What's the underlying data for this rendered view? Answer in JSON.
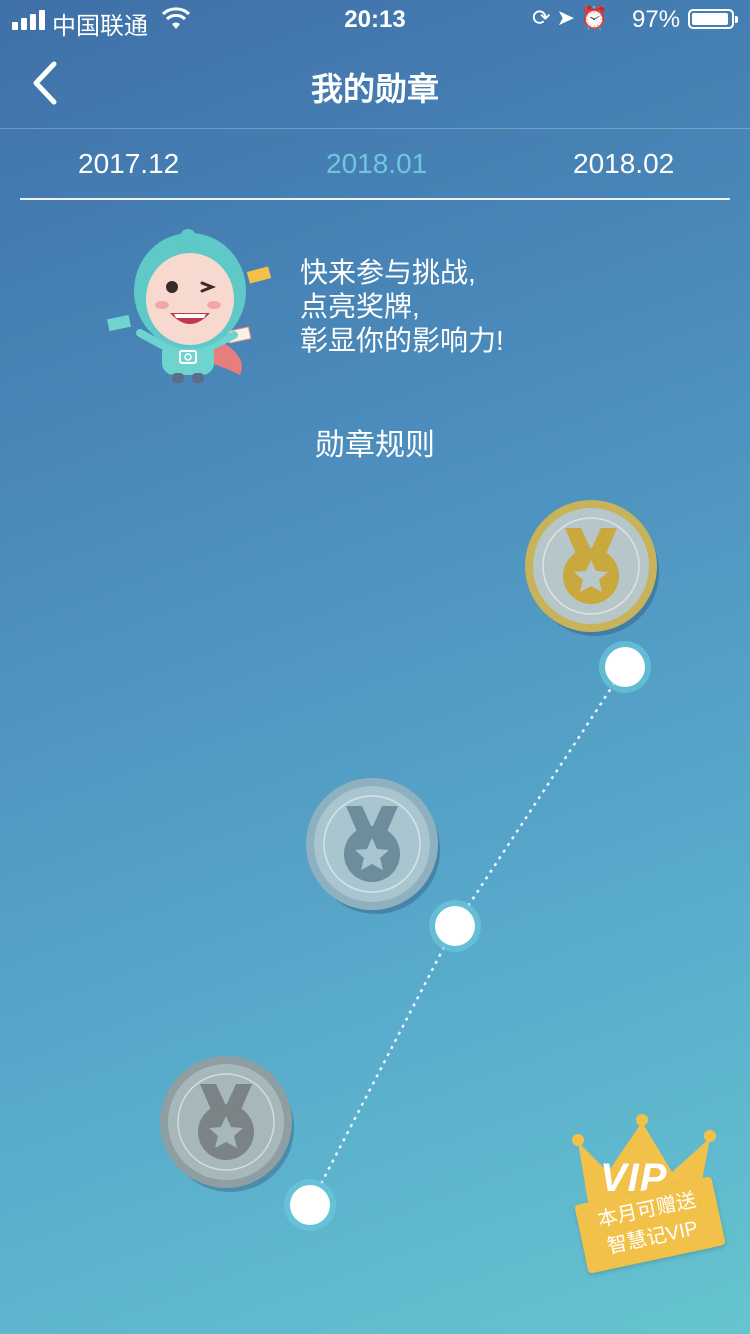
{
  "status_bar": {
    "carrier": "中国联通",
    "time": "20:13",
    "battery_percent": "97%",
    "battery_level": 0.97
  },
  "nav": {
    "title": "我的勋章"
  },
  "tabs": [
    {
      "label": "2017.12",
      "selected": false
    },
    {
      "label": "2018.01",
      "selected": true
    },
    {
      "label": "2018.02",
      "selected": false
    }
  ],
  "intro": {
    "line1": "快来参与挑战,",
    "line2": "点亮奖牌,",
    "line3": "彰显你的影响力!"
  },
  "rules_link": "勋章规则",
  "vip_badge": {
    "logo_text": "VIP",
    "line1": "本月可赠送",
    "line2": "智慧记VIP"
  },
  "colors": {
    "selected_tab": "#6fc6df",
    "gold_medal": "#c9a93e",
    "vip_yellow": "#f2c14a"
  }
}
